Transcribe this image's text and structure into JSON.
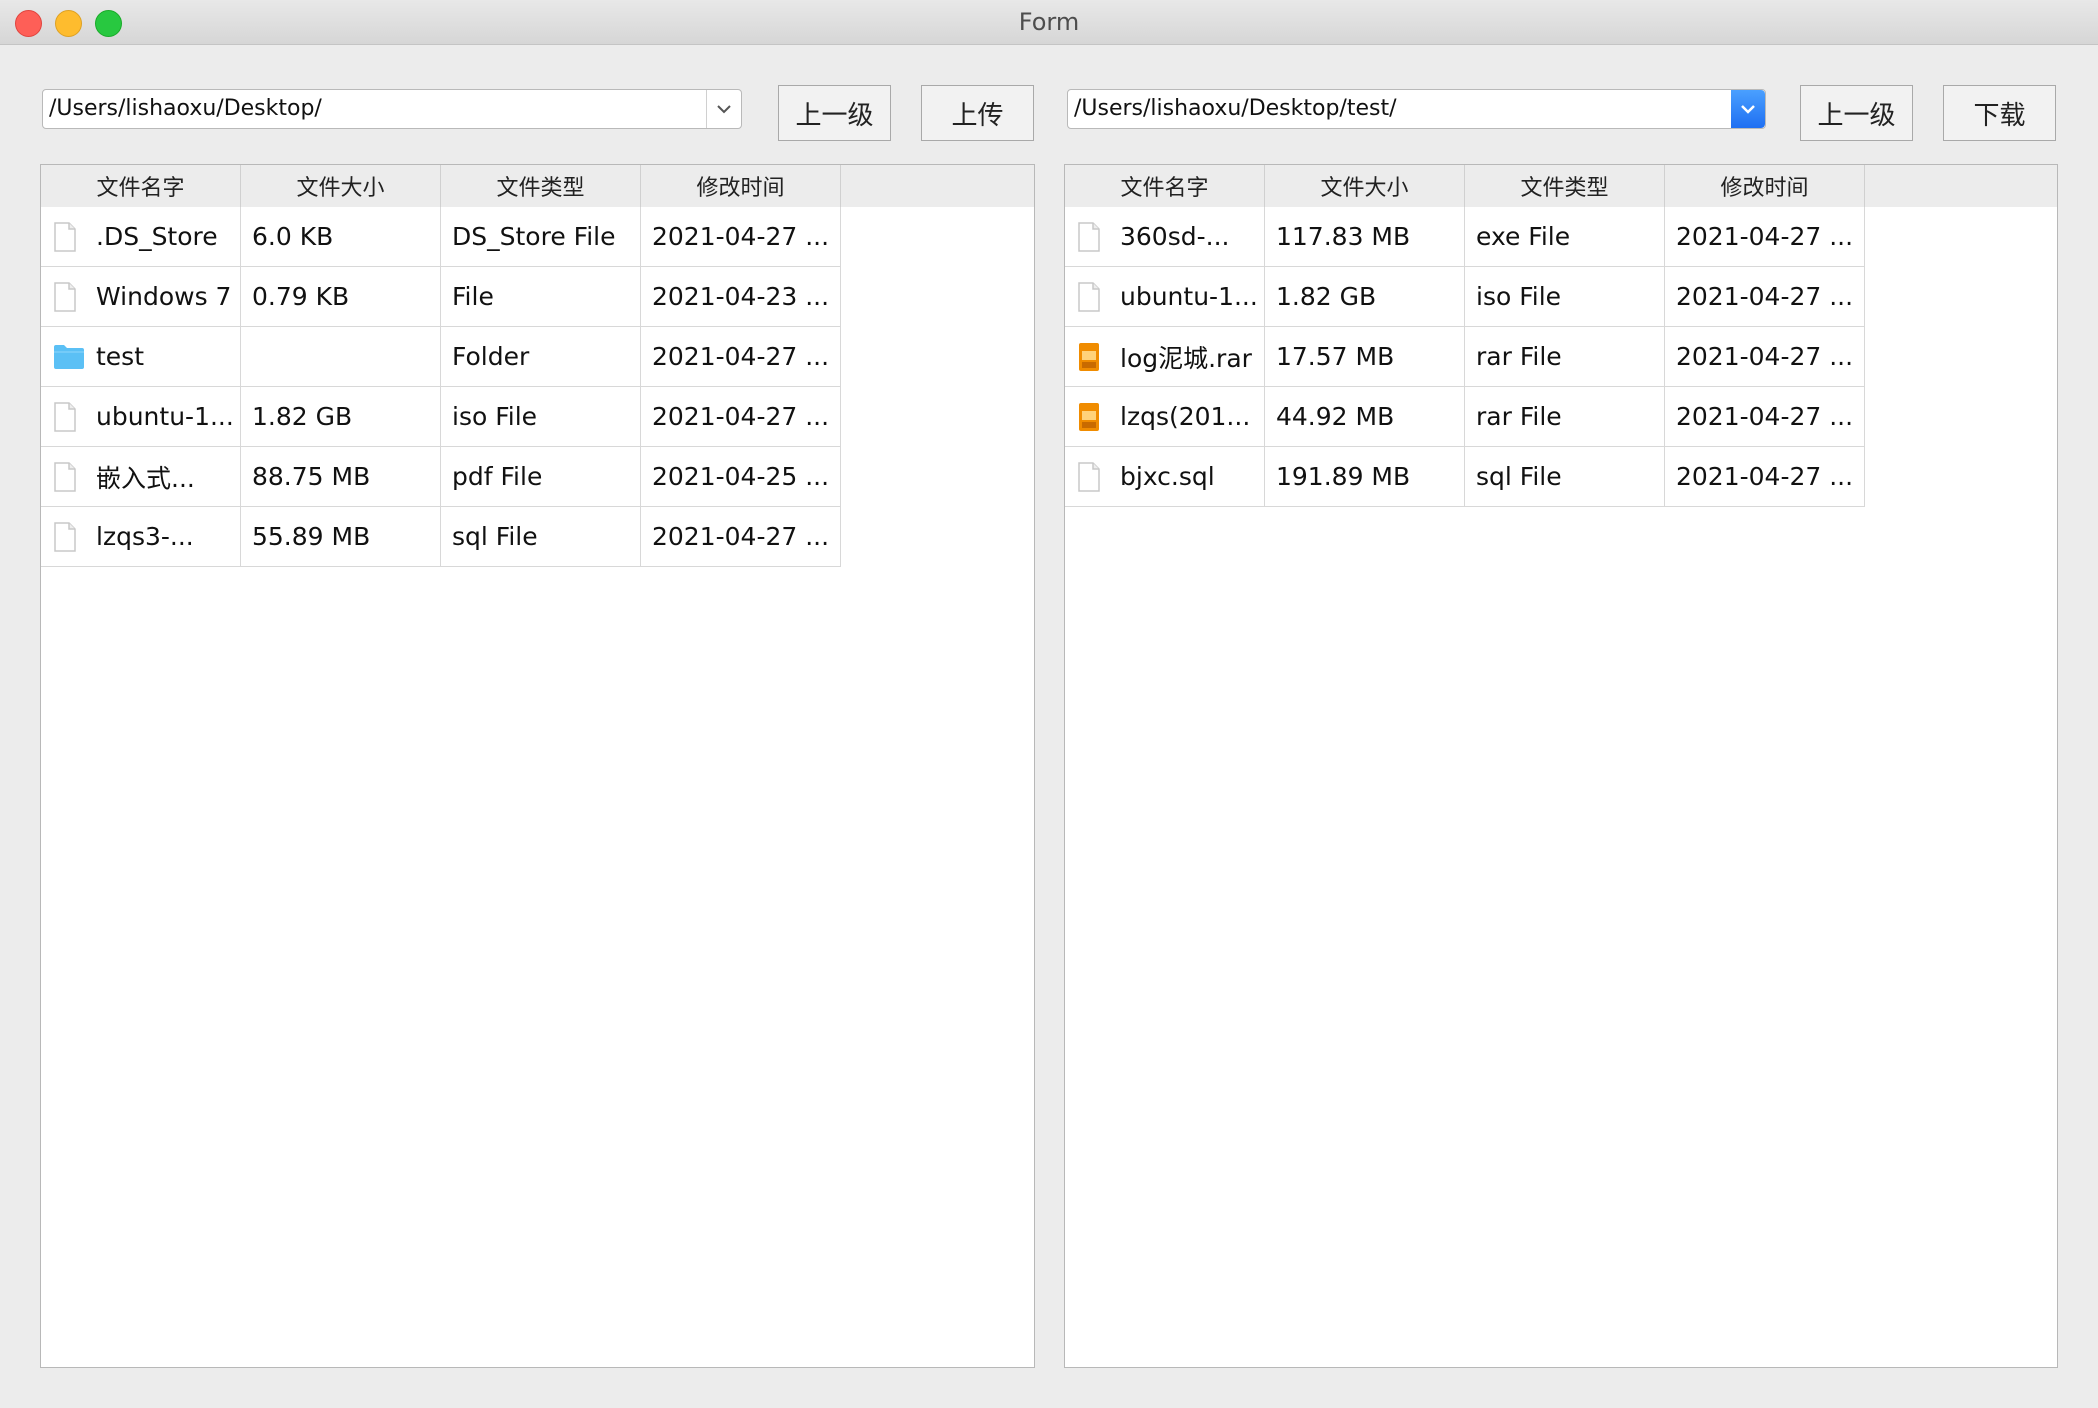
{
  "window": {
    "title": "Form"
  },
  "left": {
    "path": "/Users/lishaoxu/Desktop/",
    "up_label": "上一级",
    "action_label": "上传",
    "columns": [
      "文件名字",
      "文件大小",
      "文件类型",
      "修改时间"
    ],
    "rows": [
      {
        "name": ".DS_Store",
        "size": "6.0  KB",
        "type": "DS_Store File",
        "modified": "2021-04-27 ...",
        "icon": "file-icon"
      },
      {
        "name": "Windows 7",
        "size": "0.79  KB",
        "type": "File",
        "modified": "2021-04-23 ...",
        "icon": "file-icon"
      },
      {
        "name": "test",
        "size": "",
        "type": "Folder",
        "modified": "2021-04-27 ...",
        "icon": "folder-icon"
      },
      {
        "name": "ubuntu-1...",
        "size": "1.82 GB",
        "type": "iso File",
        "modified": "2021-04-27 ...",
        "icon": "file-icon"
      },
      {
        "name": "嵌入式...",
        "size": "88.75  MB",
        "type": "pdf File",
        "modified": "2021-04-25 ...",
        "icon": "file-icon"
      },
      {
        "name": "lzqs3-...",
        "size": "55.89  MB",
        "type": "sql File",
        "modified": "2021-04-27 ...",
        "icon": "file-icon"
      }
    ]
  },
  "right": {
    "path": "/Users/lishaoxu/Desktop/test/",
    "up_label": "上一级",
    "action_label": "下载",
    "columns": [
      "文件名字",
      "文件大小",
      "文件类型",
      "修改时间"
    ],
    "rows": [
      {
        "name": "360sd-...",
        "size": "117.83  MB",
        "type": "exe File",
        "modified": "2021-04-27 ...",
        "icon": "file-icon"
      },
      {
        "name": "ubuntu-1...",
        "size": "1.82 GB",
        "type": "iso File",
        "modified": "2021-04-27 ...",
        "icon": "file-icon"
      },
      {
        "name": "log泥城.rar",
        "size": "17.57  MB",
        "type": "rar File",
        "modified": "2021-04-27 ...",
        "icon": "archive-icon"
      },
      {
        "name": "lzqs(201...",
        "size": "44.92  MB",
        "type": "rar File",
        "modified": "2021-04-27 ...",
        "icon": "archive-icon"
      },
      {
        "name": "bjxc.sql",
        "size": "191.89  MB",
        "type": "sql File",
        "modified": "2021-04-27 ...",
        "icon": "file-icon"
      }
    ]
  },
  "colors": {
    "accent": "#1f6ff2",
    "folder": "#5bc0f5",
    "archive": "#f08c00"
  }
}
